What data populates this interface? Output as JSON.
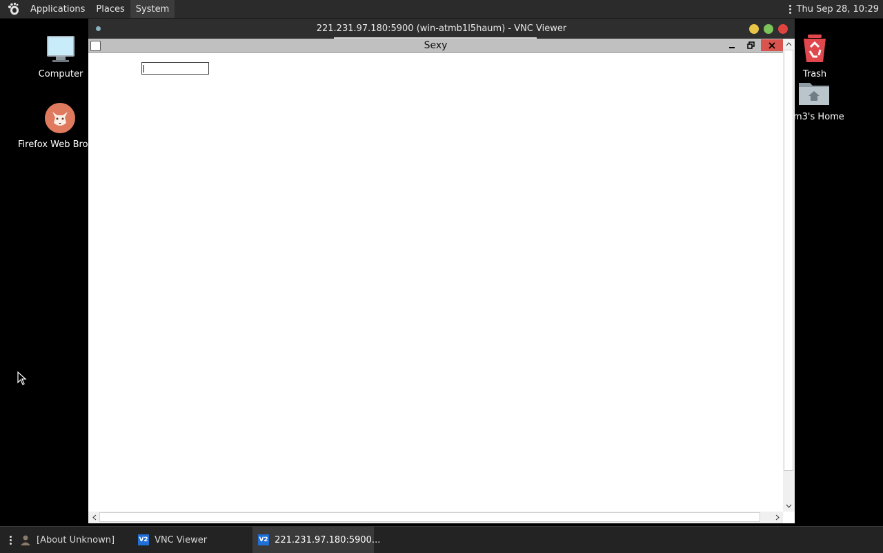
{
  "top_panel": {
    "menus": [
      "Applications",
      "Places",
      "System"
    ],
    "clock": "Thu Sep 28, 10:29"
  },
  "desktop": {
    "icons": {
      "computer": "Computer",
      "firefox": "Firefox Web Brow",
      "trash": "Trash",
      "home": "m3's Home"
    }
  },
  "vnc_window": {
    "title": "221.231.97.180:5900 (win-atmb1l5haum) - VNC Viewer",
    "remote_window": {
      "title": "Sexy",
      "input_value": ""
    }
  },
  "taskbar": {
    "items": [
      "[About Unknown]",
      "VNC Viewer",
      "221.231.97.180:5900..."
    ]
  },
  "colors": {
    "minimize_button": "#e8c547",
    "maximize_button": "#7bc35a",
    "close_button": "#e0443e",
    "remote_close_bg": "#d9534f"
  },
  "icon_names": [
    "gnome-foot-icon",
    "computer-icon",
    "firefox-icon",
    "trash-icon",
    "home-folder-icon",
    "vnc-icon",
    "user-icon",
    "mouse-cursor-icon"
  ]
}
